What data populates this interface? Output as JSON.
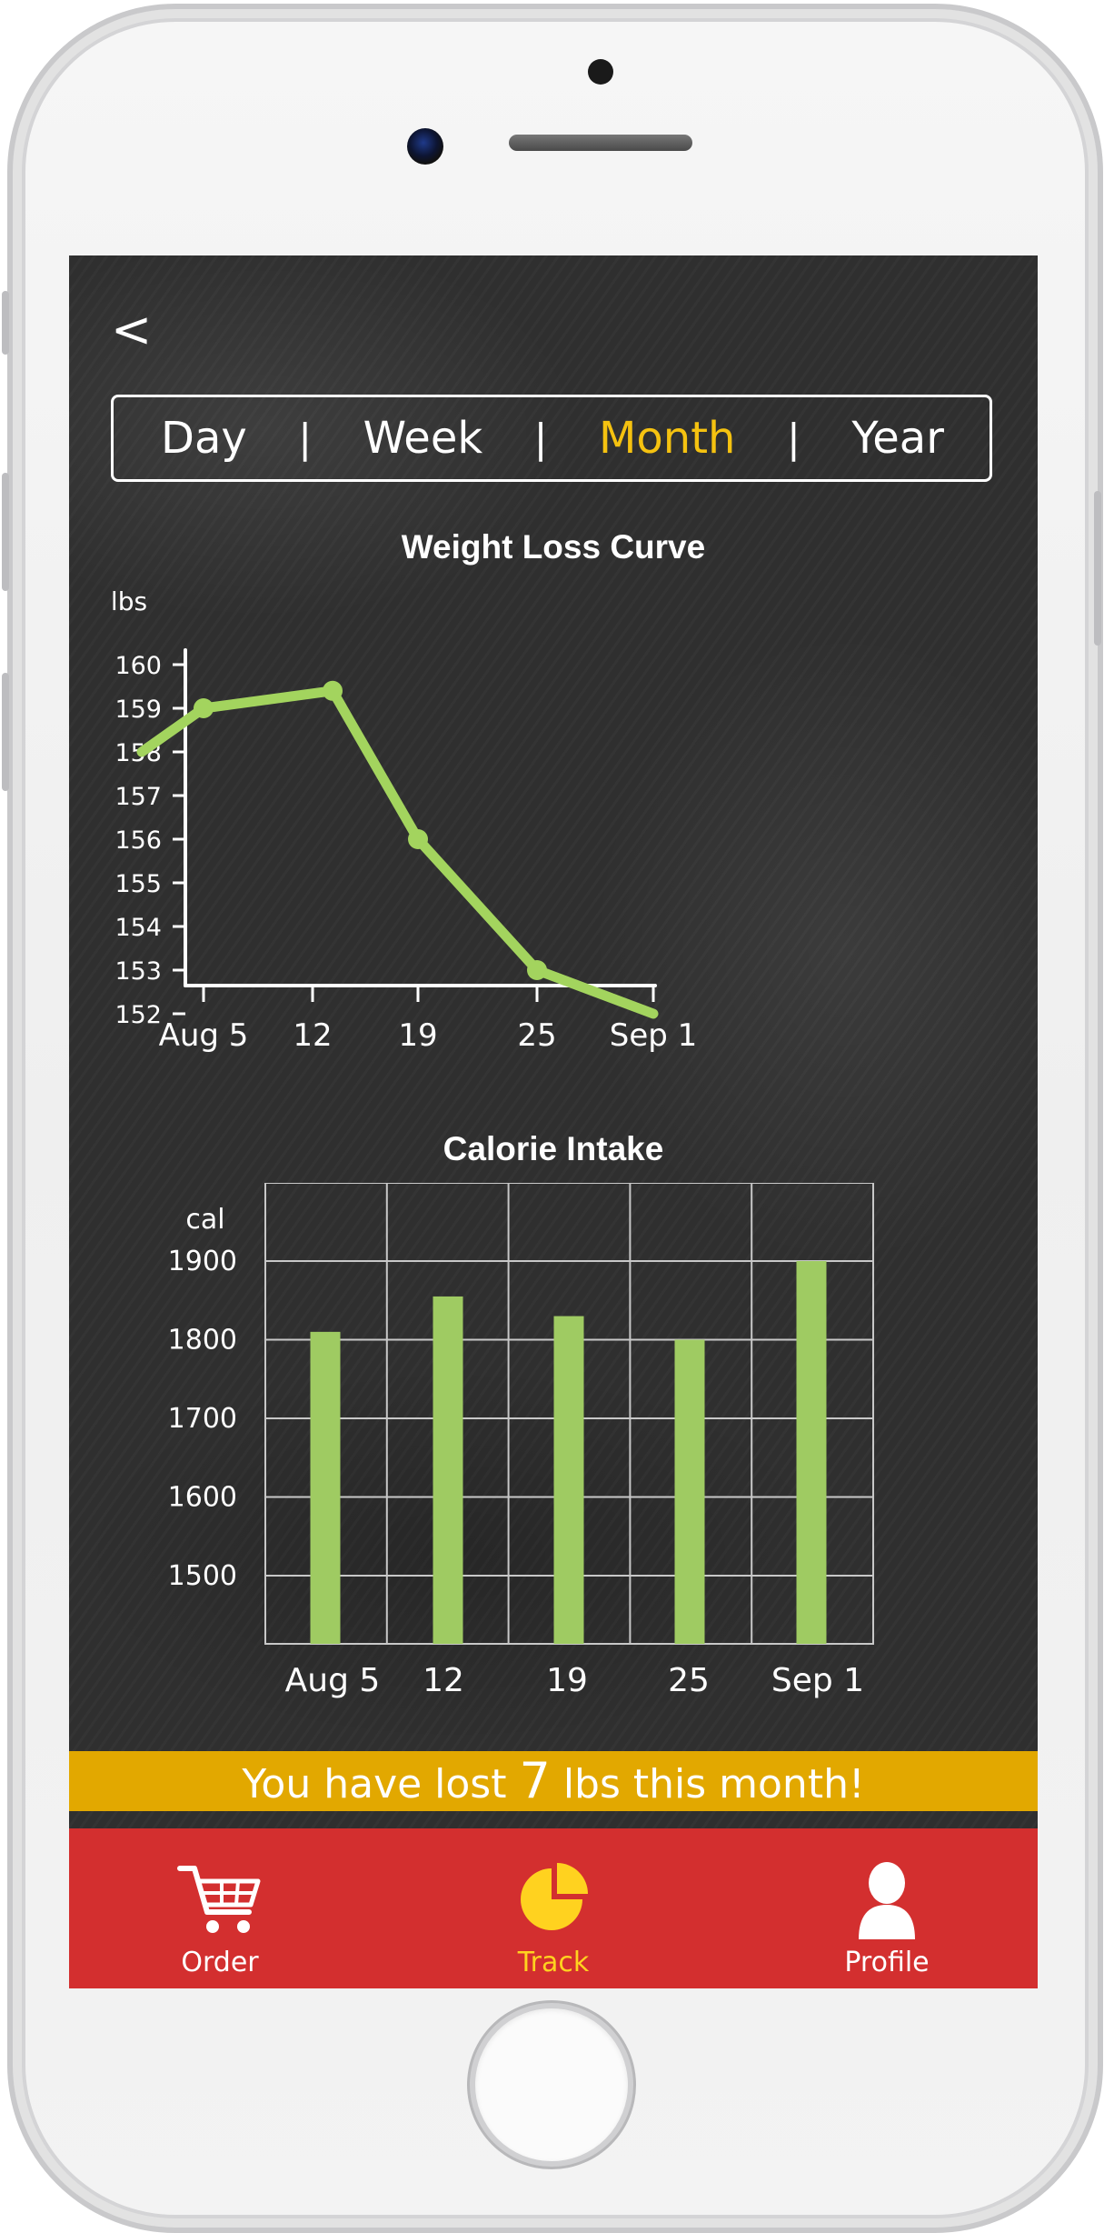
{
  "tabs": {
    "items": [
      "Day",
      "Week",
      "Month",
      "Year"
    ],
    "active": "Month",
    "separator": "|"
  },
  "back": {
    "label": "<"
  },
  "weight_chart": {
    "title": "Weight Loss Curve",
    "ylabel": "lbs"
  },
  "calorie_chart": {
    "title": "Calorie Intake",
    "ylabel": "cal"
  },
  "banner": {
    "prefix": "You have lost ",
    "number": "7",
    "suffix": " lbs this month!"
  },
  "nav": {
    "order": "Order",
    "track": "Track",
    "profile": "Profile"
  },
  "colors": {
    "accent": "#f5c210",
    "line": "#a3d45e",
    "bar": "#9fcb62",
    "banner": "#e2a800",
    "nav": "#d32f2f"
  },
  "chart_data": [
    {
      "type": "line",
      "title": "Weight Loss Curve",
      "ylabel": "lbs",
      "xlabel": "",
      "x_ticks": [
        "Aug 5",
        "12",
        "19",
        "25",
        "Sep 1"
      ],
      "y_ticks": [
        152,
        153,
        154,
        155,
        156,
        157,
        158,
        159,
        160
      ],
      "ylim": [
        151.5,
        160.5
      ],
      "points": [
        {
          "x": "Aug 3",
          "y": 158
        },
        {
          "x": "Aug 5",
          "y": 159
        },
        {
          "x": "Aug 14",
          "y": 159.4
        },
        {
          "x": "Aug 19",
          "y": 156
        },
        {
          "x": "Aug 25",
          "y": 153
        },
        {
          "x": "Sep 1",
          "y": 152
        }
      ]
    },
    {
      "type": "bar",
      "title": "Calorie Intake",
      "ylabel": "cal",
      "xlabel": "",
      "categories": [
        "Aug 5",
        "12",
        "19",
        "25",
        "Sep 1"
      ],
      "values": [
        1810,
        1855,
        1830,
        1800,
        1900
      ],
      "y_ticks": [
        1500,
        1600,
        1700,
        1800,
        1900
      ],
      "ylim": [
        1400,
        1950
      ],
      "grid": true
    }
  ]
}
